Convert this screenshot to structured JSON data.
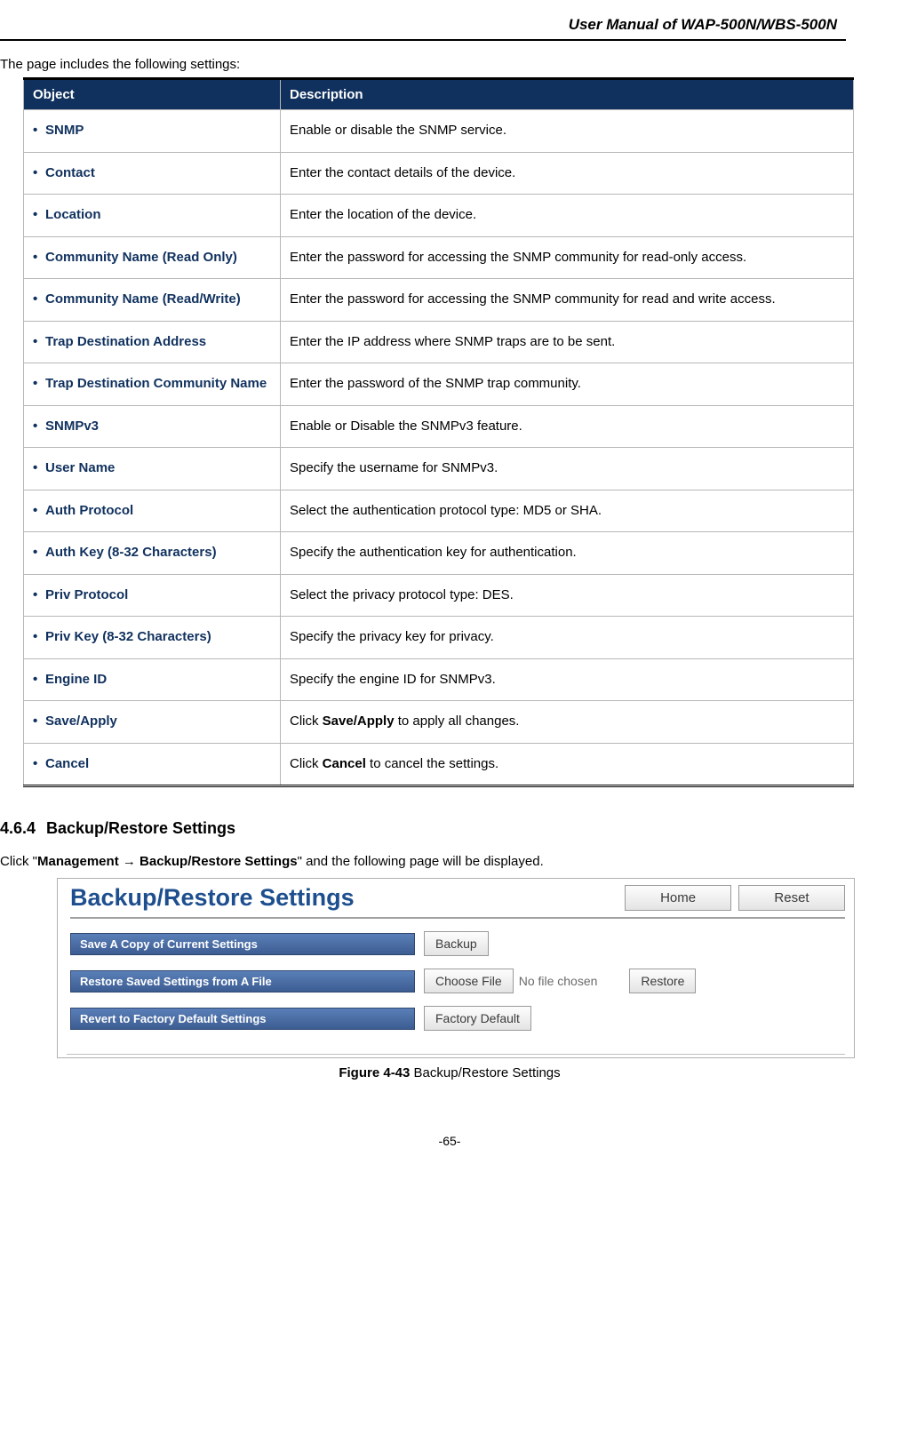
{
  "header": {
    "title": "User Manual of WAP-500N/WBS-500N"
  },
  "intro": "The page includes the following settings:",
  "table": {
    "headers": {
      "object": "Object",
      "description": "Description"
    },
    "rows": [
      {
        "object": "SNMP",
        "description": "Enable or disable the SNMP service."
      },
      {
        "object": "Contact",
        "description": "Enter the contact details of the device."
      },
      {
        "object": "Location",
        "description": "Enter the location of the device."
      },
      {
        "object": "Community Name (Read Only)",
        "description": "Enter the password for accessing the SNMP community for read-only access."
      },
      {
        "object": "Community Name (Read/Write)",
        "description": "Enter the password for accessing the SNMP community for read and write access."
      },
      {
        "object": "Trap Destination Address",
        "description": "Enter the IP address where SNMP traps are to be sent."
      },
      {
        "object": "Trap Destination Community Name",
        "description": "Enter the password of the SNMP trap community."
      },
      {
        "object": "SNMPv3",
        "description": "Enable or Disable the SNMPv3 feature."
      },
      {
        "object": "User Name",
        "description": "Specify the username for SNMPv3."
      },
      {
        "object": "Auth Protocol",
        "description": "Select the authentication protocol type: MD5 or SHA."
      },
      {
        "object": "Auth Key (8-32 Characters)",
        "description": "Specify the authentication key for authentication."
      },
      {
        "object": "Priv Protocol",
        "description": "Select the privacy protocol type: DES."
      },
      {
        "object": "Priv Key (8-32 Characters)",
        "description": "Specify the privacy key for privacy."
      },
      {
        "object": "Engine ID",
        "description": "Specify the engine ID for SNMPv3."
      },
      {
        "object": "Save/Apply",
        "description_prefix": "Click ",
        "description_bold": "Save/Apply",
        "description_suffix": " to apply all changes."
      },
      {
        "object": "Cancel",
        "description_prefix": "Click ",
        "description_bold": "Cancel",
        "description_suffix": " to cancel the settings."
      }
    ]
  },
  "section": {
    "number": "4.6.4",
    "title": "Backup/Restore Settings",
    "click_prefix": "Click \"",
    "click_bold1": "Management ",
    "click_arrow": "→",
    "click_bold2": " Backup/Restore Settings",
    "click_suffix": "\" and the following page will be displayed."
  },
  "screenshot": {
    "title": "Backup/Restore Settings",
    "home_btn": "Home",
    "reset_btn": "Reset",
    "row1_label": "Save A Copy of Current Settings",
    "row1_btn": "Backup",
    "row2_label": "Restore Saved Settings from A File",
    "row2_choose": "Choose File",
    "row2_nofile": "No file chosen",
    "row2_restore": "Restore",
    "row3_label": "Revert to Factory Default Settings",
    "row3_btn": "Factory Default"
  },
  "figure": {
    "label": "Figure 4-43",
    "caption": " Backup/Restore Settings"
  },
  "page_number": "-65-"
}
